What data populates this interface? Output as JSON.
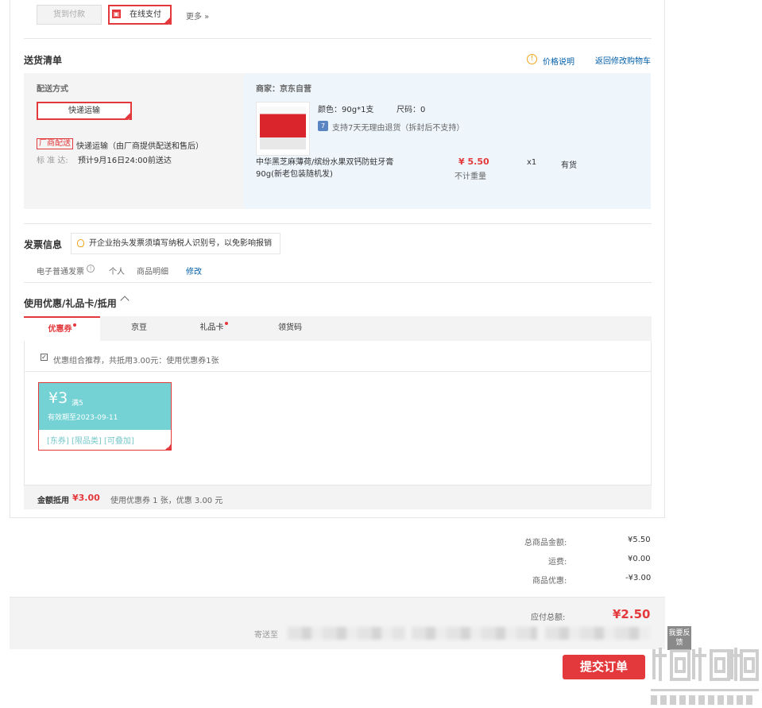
{
  "payment": {
    "cod_label": "货到付款",
    "online_label": "在线支付",
    "more_label": "更多 »"
  },
  "delivery_list": {
    "title": "送货清单",
    "price_note": "价格说明",
    "back_cart": "返回修改购物车",
    "method_title": "配送方式",
    "method_button": "快递运输",
    "vendor_badge": "厂商配送",
    "vendor_text": "快递运输（由厂商提供配送和售后）",
    "standard_label": "标 准 达:",
    "standard_text": "预计9月16日24:00前送达",
    "merchant": "商家：京东自营",
    "color_label": "颜色：90g*1支",
    "size_label": "尺码：0",
    "return_badge": "7",
    "return_text": "支持7天无理由退货（拆封后不支持）",
    "product_name_line1": "中华黑芝麻薄荷/缤纷水果双钙防蛀牙膏",
    "product_name_line2": "90g(新老包装随机发)",
    "price": "¥ 5.50",
    "weight": "不计重量",
    "qty": "x1",
    "stock": "有货"
  },
  "invoice": {
    "title": "发票信息",
    "tip": "开企业抬头发票须填写纳税人识别号，以免影响报销",
    "type": "电子普通发票",
    "holder": "个人",
    "content": "商品明细",
    "edit": "修改"
  },
  "coupons": {
    "title": "使用优惠/礼品卡/抵用",
    "tabs": [
      "优惠券",
      "京豆",
      "礼品卡",
      "领货码"
    ],
    "recommend_text": "优惠组合推荐，共抵用3.00元：使用优惠券1张",
    "coupon_amount": "¥3",
    "coupon_condition": "满5",
    "coupon_expiry": "有效期至2023-09-11",
    "coupon_tags": "[东券]  [限品类]  [可叠加]",
    "footer_label": "金额抵用",
    "footer_amount": "¥3.00",
    "footer_text": "使用优惠券 1 张，优惠 3.00 元"
  },
  "summary": {
    "total_label": "总商品金额:",
    "total_value": "¥5.50",
    "freight_label": "运费:",
    "freight_value": "¥0.00",
    "discount_label": "商品优惠:",
    "discount_value": "-¥3.00",
    "payable_label": "应付总额:",
    "payable_value": "¥2.50",
    "ship_to_label": "寄送至",
    "submit": "提交订单",
    "feedback": "我要反馈"
  },
  "colors": {
    "accent": "#e4393c",
    "link": "#005ea7",
    "coupon": "#74d2d4",
    "panel_blue": "#eef6fc"
  }
}
